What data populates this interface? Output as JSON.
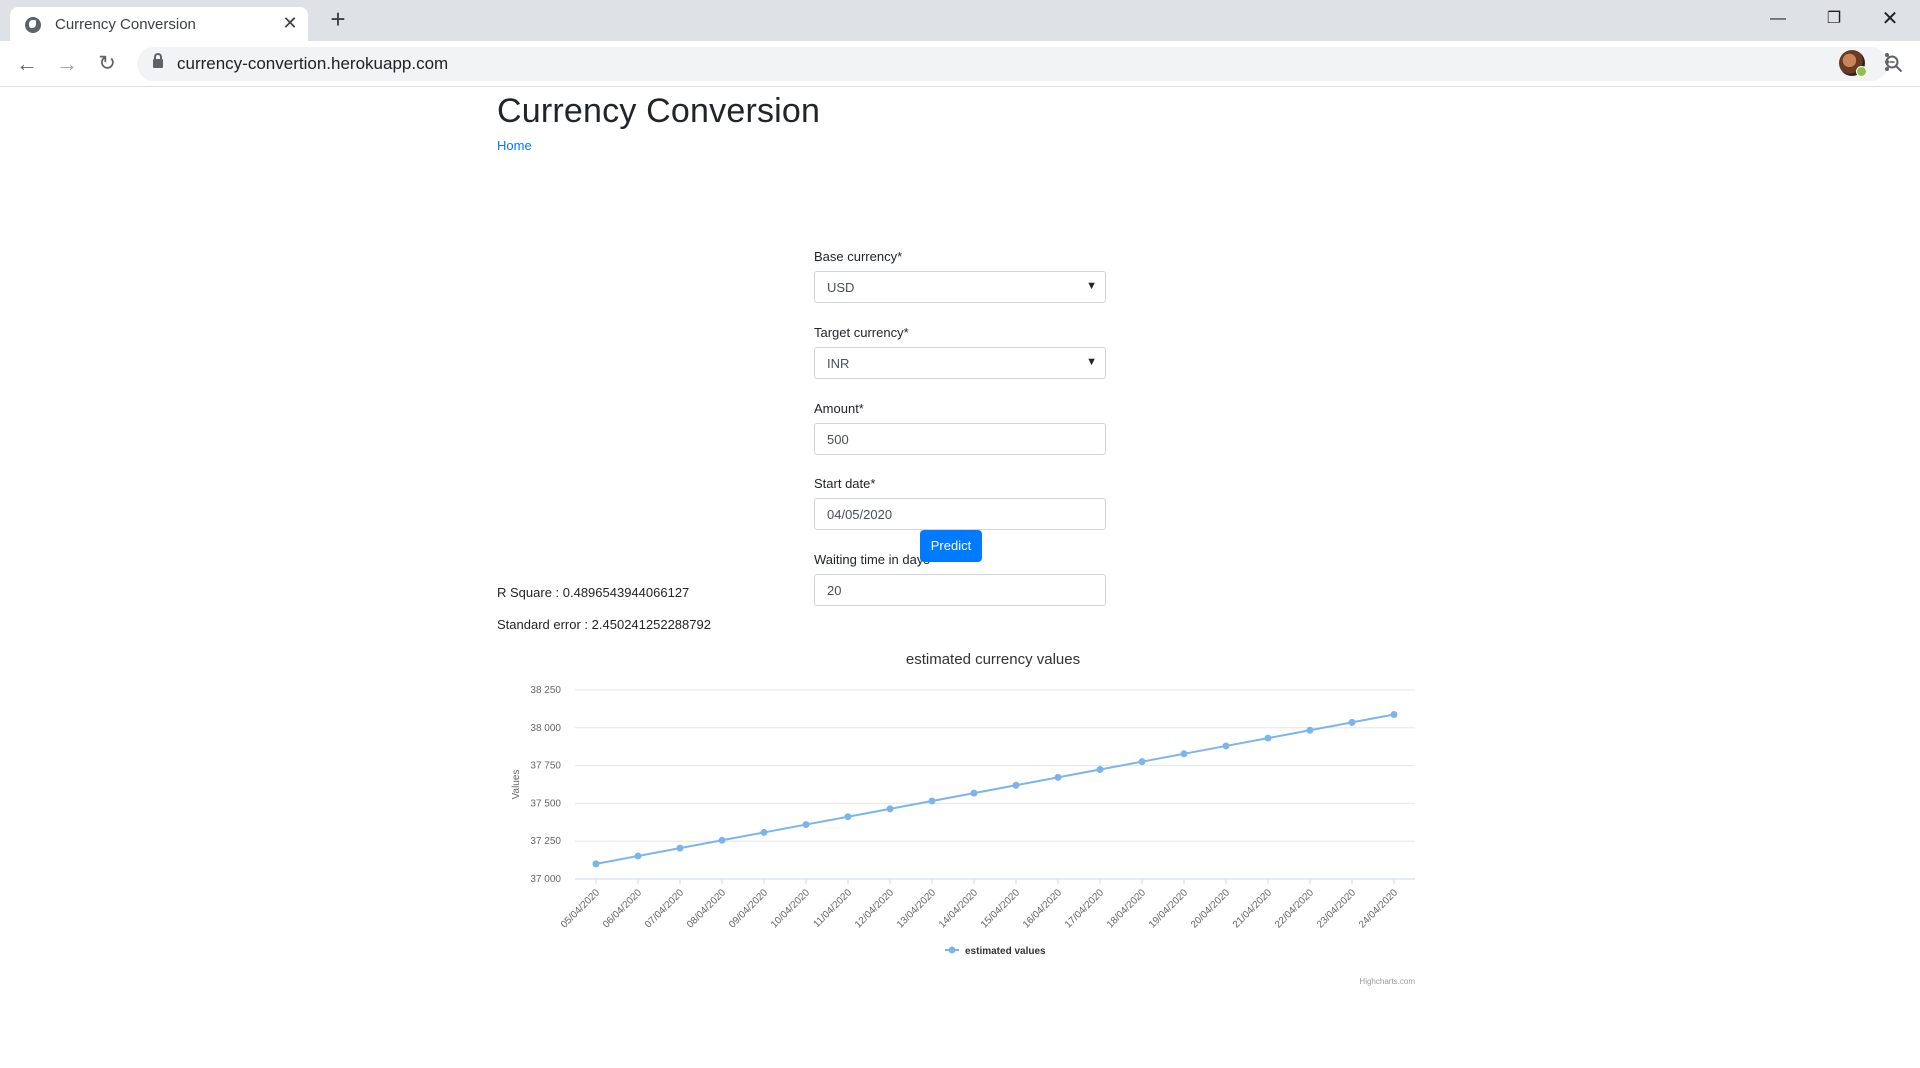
{
  "browser": {
    "tab_title": "Currency Conversion",
    "tab_close": "✕",
    "new_tab": "+",
    "url": "currency-convertion.herokuapp.com",
    "window_controls": {
      "minimize": "—",
      "maximize": "❐",
      "close": "✕"
    },
    "nav": {
      "back": "←",
      "forward": "→",
      "reload": "↻"
    },
    "star": "☆"
  },
  "page": {
    "title": "Currency Conversion",
    "home_link": "Home"
  },
  "form": {
    "base_currency": {
      "label": "Base currency*",
      "value": "USD"
    },
    "target_currency": {
      "label": "Target currency*",
      "value": "INR"
    },
    "amount": {
      "label": "Amount*",
      "value": "500"
    },
    "start_date": {
      "label": "Start date*",
      "value": "04/05/2020"
    },
    "waiting_time": {
      "label": "Waiting time in days*",
      "value": "20"
    },
    "predict_label": "Predict"
  },
  "stats": {
    "r_square": "R Square : 0.4896543944066127",
    "standard_error": "Standard error : 2.450241252288792"
  },
  "chart_data": {
    "type": "line",
    "title": "estimated currency values",
    "xlabel": "",
    "ylabel": "Values",
    "ylim": [
      37000,
      38250
    ],
    "yticks": [
      "37 000",
      "37 250",
      "37 500",
      "37 750",
      "38 000",
      "38 250"
    ],
    "categories": [
      "05/04/2020",
      "06/04/2020",
      "07/04/2020",
      "08/04/2020",
      "09/04/2020",
      "10/04/2020",
      "11/04/2020",
      "12/04/2020",
      "13/04/2020",
      "14/04/2020",
      "15/04/2020",
      "16/04/2020",
      "17/04/2020",
      "18/04/2020",
      "19/04/2020",
      "20/04/2020",
      "21/04/2020",
      "22/04/2020",
      "23/04/2020",
      "24/04/2020"
    ],
    "series": [
      {
        "name": "estimated values",
        "color": "#7cb5ec",
        "values": [
          37100,
          37152,
          37204,
          37256,
          37308,
          37360,
          37412,
          37464,
          37516,
          37568,
          37620,
          37672,
          37724,
          37776,
          37828,
          37880,
          37932,
          37984,
          38036,
          38088
        ]
      }
    ],
    "grid": true,
    "legend_position": "bottom-center",
    "credits": "Highcharts.com"
  }
}
